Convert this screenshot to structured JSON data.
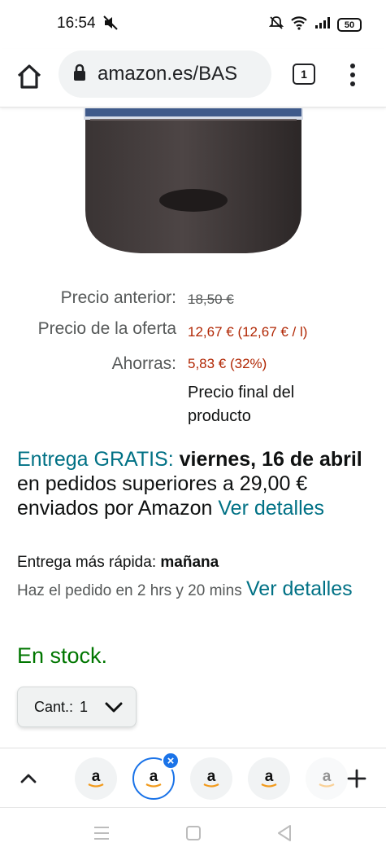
{
  "status_bar": {
    "time": "16:54",
    "battery": "50"
  },
  "browser": {
    "url": "amazon.es/BAS",
    "tab_count": "1"
  },
  "price": {
    "previous_label": "Precio anterior:",
    "previous_value": "18,50 €",
    "deal_label": "Precio de la oferta",
    "deal_value": "12,67 € (12,67 € / l)",
    "savings_label": "Ahorras:",
    "savings_value": "5,83 € (32%)",
    "final_note": "Precio final del producto"
  },
  "delivery": {
    "free_label": "Entrega GRATIS:",
    "date": "viernes, 16 de abril",
    "text": "en pedidos superiores a 29,00 € enviados por Amazon",
    "details_link": "Ver detalles",
    "fastest_label": "Entrega más rápida:",
    "fastest_value": "mañana",
    "order_text": "Haz el pedido en 2 hrs y 20 mins",
    "order_link": "Ver detalles"
  },
  "stock": {
    "status": "En stock."
  },
  "quantity": {
    "label": "Cant.:",
    "value": "1"
  },
  "tab_strip": {
    "tabs": [
      "a",
      "a",
      "a",
      "a",
      "a"
    ]
  },
  "colors": {
    "teal": "#007185",
    "price_red": "#b12704",
    "stock_green": "#007600",
    "active_tab": "#1a73e8"
  }
}
